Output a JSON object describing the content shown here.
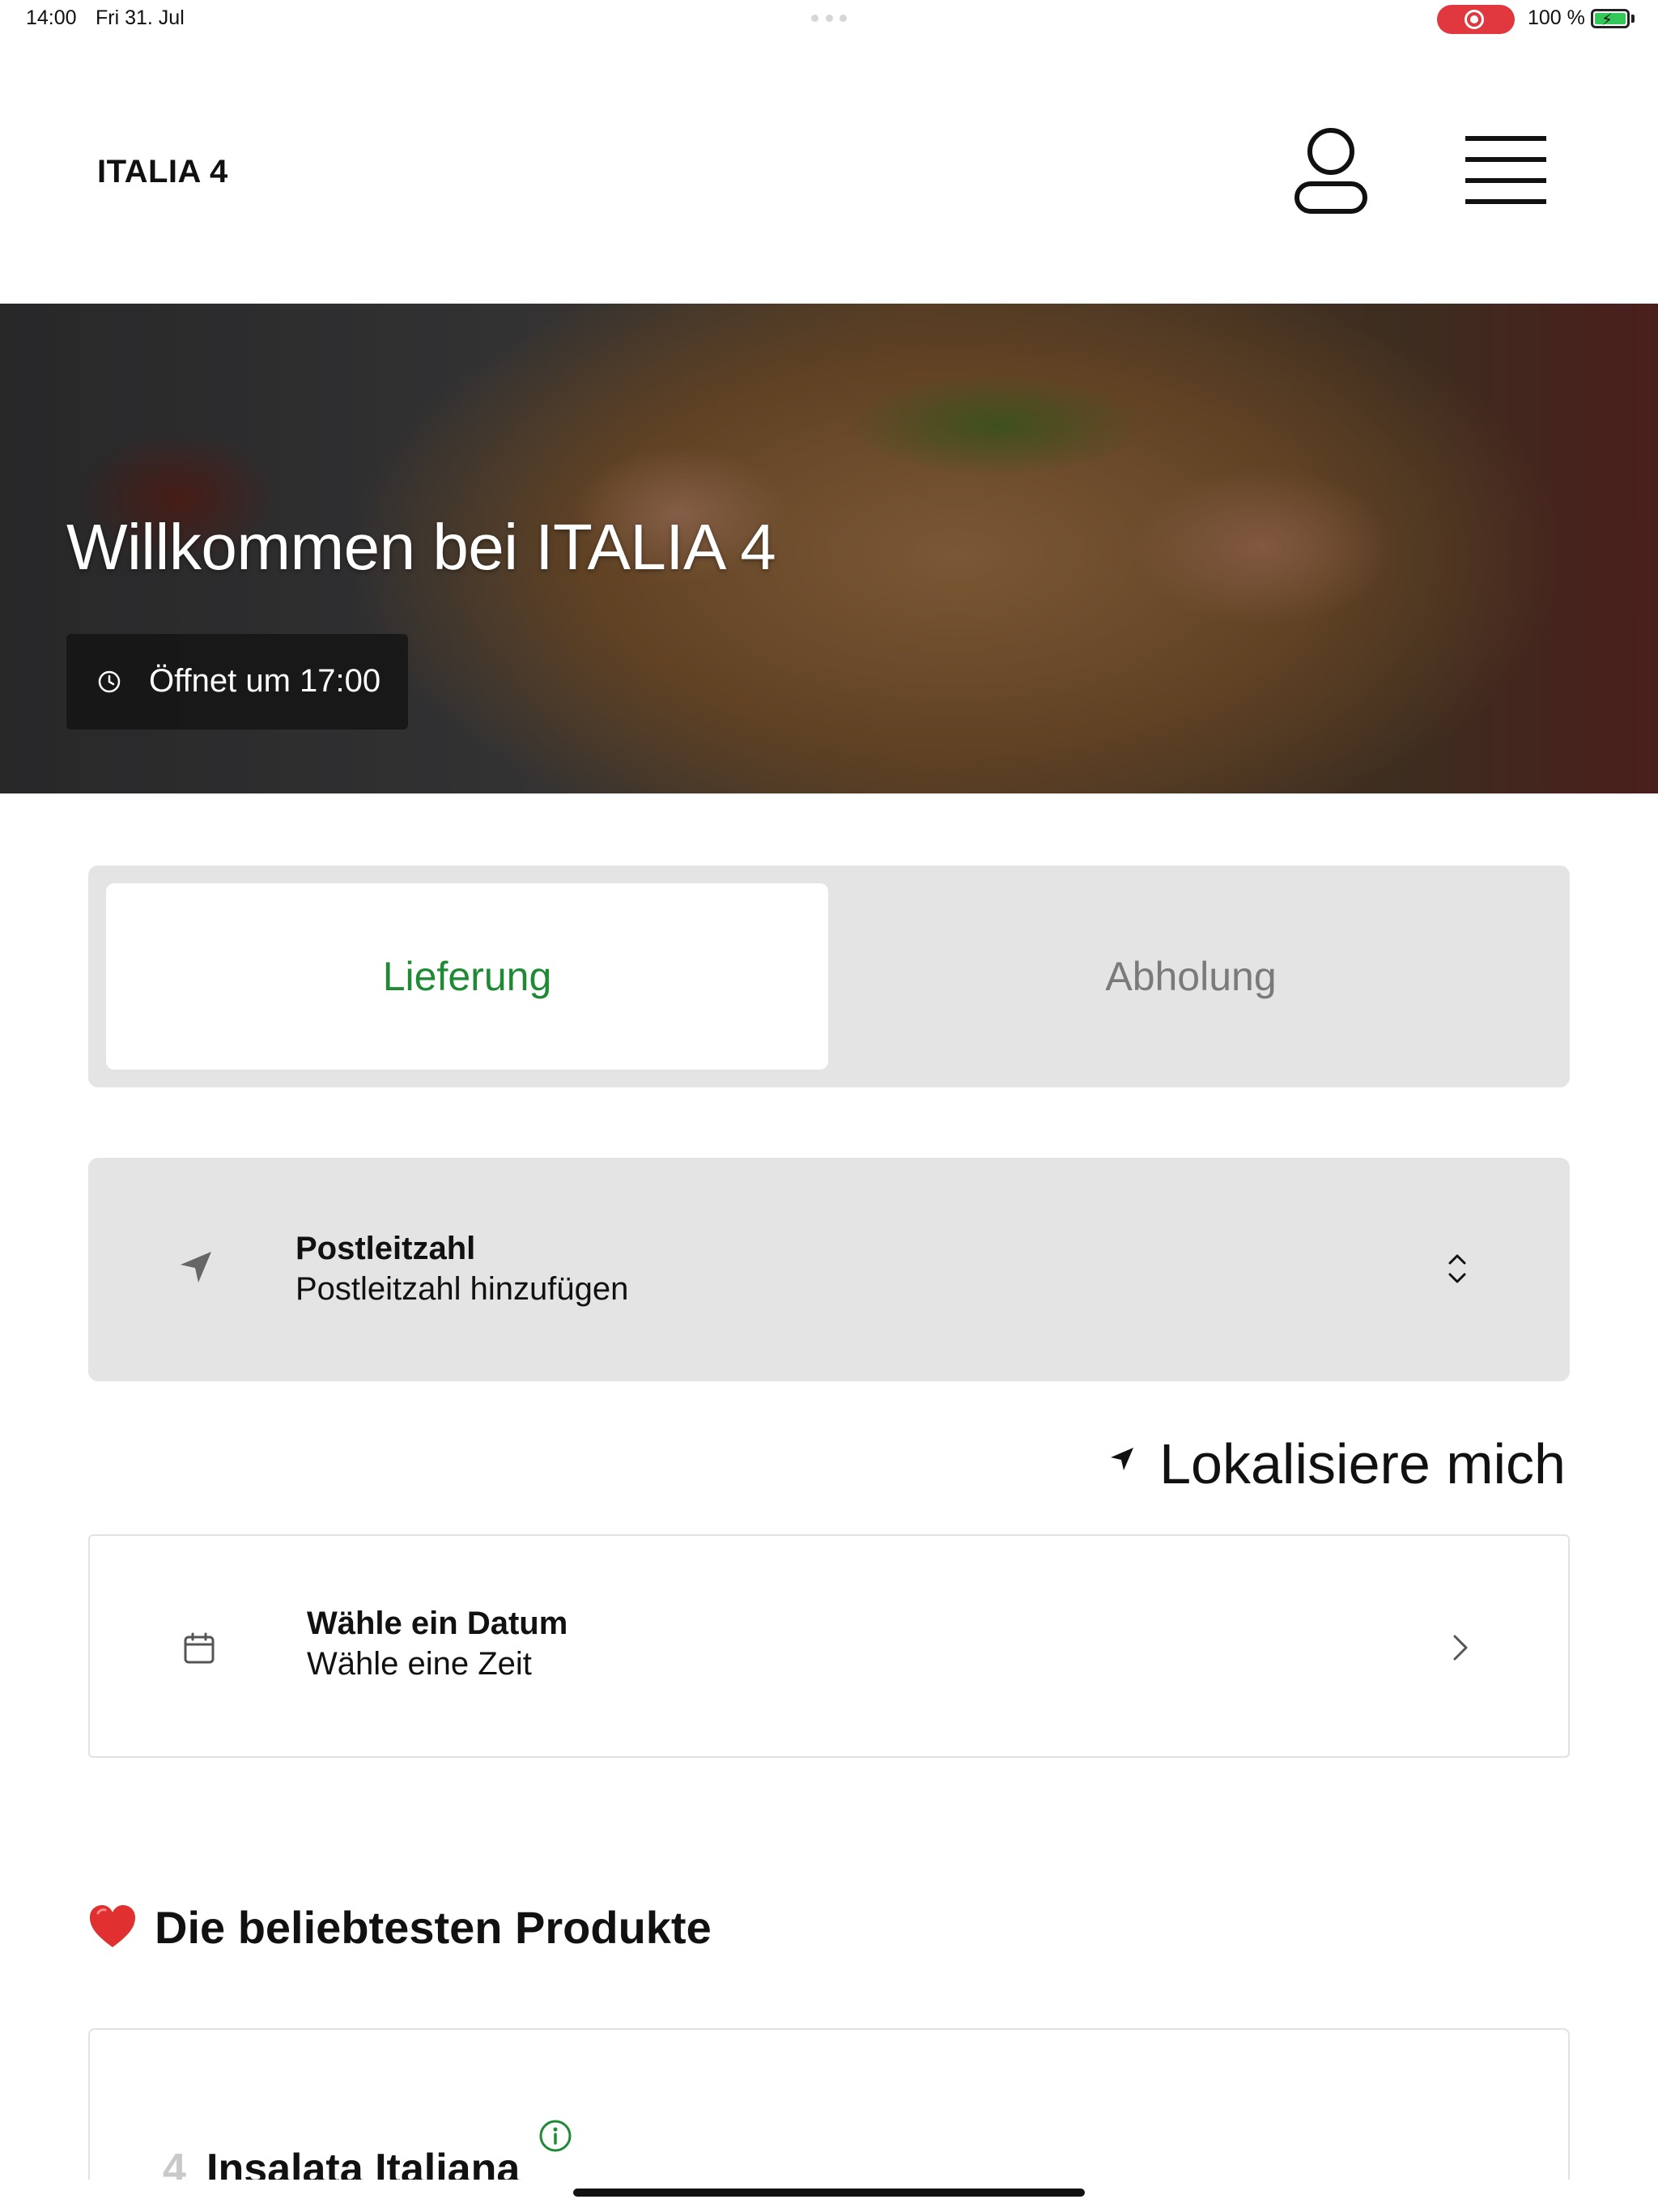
{
  "status_bar": {
    "time": "14:00",
    "date": "Fri 31. Jul",
    "battery": "100 %",
    "recording_indicator": "screen-recording-icon"
  },
  "header": {
    "brand": "ITALIA 4",
    "user_icon": "user-icon",
    "menu_icon": "menu-icon"
  },
  "hero": {
    "title": "Willkommen bei ITALIA 4",
    "hours": "Öffnet um 17:00",
    "hours_icon": "clock-icon"
  },
  "order_mode": {
    "tabs": [
      {
        "label": "Lieferung",
        "selected": true
      },
      {
        "label": "Abholung",
        "selected": false
      }
    ]
  },
  "postal_code": {
    "title": "Postleitzahl",
    "placeholder": "Postleitzahl hinzufügen",
    "icon": "location-arrow-icon"
  },
  "locate": {
    "label": "Lokalisiere mich",
    "icon": "location-arrow-icon"
  },
  "schedule": {
    "title": "Wähle ein Datum",
    "subtitle": "Wähle eine Zeit",
    "icon": "calendar-icon"
  },
  "popular": {
    "emoji": "❤️",
    "heading": "Die beliebtesten Produkte",
    "products": [
      {
        "number": "4",
        "name": "Insalata Italiana"
      }
    ]
  },
  "colors": {
    "accent_green": "#1f8a34",
    "segment_bg": "#e4e4e4",
    "heart_red": "#e0302f",
    "record_red": "#e0383e"
  }
}
